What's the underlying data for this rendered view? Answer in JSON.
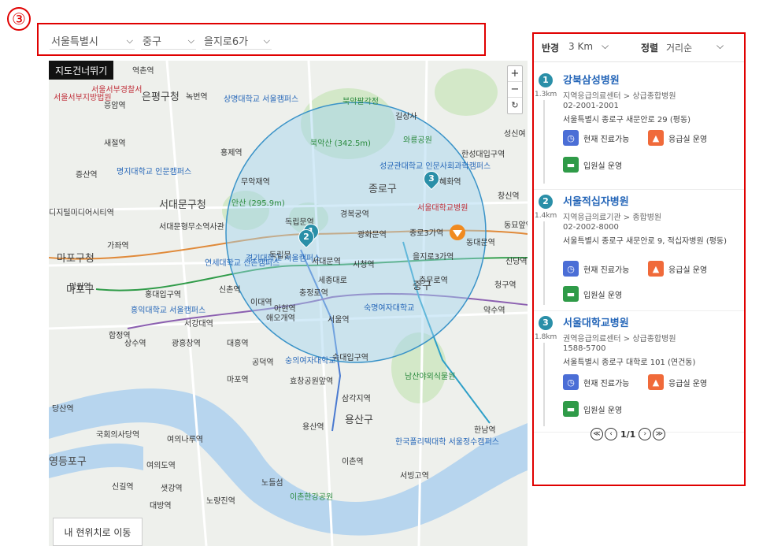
{
  "annotation": {
    "label": "③"
  },
  "filters": {
    "city": "서울특별시",
    "district": "중구",
    "neighborhood": "을지로6가"
  },
  "map": {
    "skip_label": "지도건너뛰기",
    "zoom_in": "+",
    "zoom_out": "−",
    "reset": "↻",
    "locate_label": "내 현위치로 이동",
    "labels": [
      {
        "text": "은평구청",
        "cls": "big"
      },
      {
        "text": "서대문구청",
        "cls": "big"
      },
      {
        "text": "마포구청",
        "cls": "big"
      },
      {
        "text": "마포구",
        "cls": "big"
      },
      {
        "text": "종로구",
        "cls": "big"
      },
      {
        "text": "용산구",
        "cls": "big"
      },
      {
        "text": "영등포구",
        "cls": "big"
      },
      {
        "text": "중구",
        "cls": "big"
      },
      {
        "text": "명지대학교 인문캠퍼스",
        "cls": "blue"
      },
      {
        "text": "연세대학교 신촌캠퍼스",
        "cls": "blue"
      },
      {
        "text": "경기대학교 서울캠퍼스",
        "cls": "blue"
      },
      {
        "text": "성균관대학교 인문사회과학캠퍼스",
        "cls": "blue"
      },
      {
        "text": "상명대학교 서울캠퍼스",
        "cls": "blue"
      },
      {
        "text": "홍익대학교 서울캠퍼스",
        "cls": "blue"
      },
      {
        "text": "숙명여자대학교",
        "cls": "blue"
      },
      {
        "text": "숭의여자대학교",
        "cls": "blue"
      },
      {
        "text": "한국폴리텍대학 서울정수캠퍼스",
        "cls": "blue"
      },
      {
        "text": "서울대학교병원",
        "cls": "red"
      },
      {
        "text": "북악팔각정",
        "cls": "green"
      },
      {
        "text": "북악산 (342.5m)",
        "cls": "green"
      },
      {
        "text": "안산 (295.9m)",
        "cls": "green"
      },
      {
        "text": "와룡공원",
        "cls": "green"
      },
      {
        "text": "남산야외식물원",
        "cls": "green"
      },
      {
        "text": "노들섬",
        "cls": ""
      },
      {
        "text": "이촌한강공원",
        "cls": "green"
      },
      {
        "text": "서울역",
        "cls": ""
      },
      {
        "text": "시청역",
        "cls": ""
      },
      {
        "text": "종로3가역",
        "cls": ""
      },
      {
        "text": "을지로3가역",
        "cls": ""
      },
      {
        "text": "충무로역",
        "cls": ""
      },
      {
        "text": "동대문역",
        "cls": ""
      },
      {
        "text": "신당역",
        "cls": ""
      },
      {
        "text": "청구역",
        "cls": ""
      },
      {
        "text": "약수역",
        "cls": ""
      },
      {
        "text": "공덕역",
        "cls": ""
      },
      {
        "text": "효창공원앞역",
        "cls": ""
      },
      {
        "text": "삼각지역",
        "cls": ""
      },
      {
        "text": "숙대입구역",
        "cls": ""
      },
      {
        "text": "용산역",
        "cls": ""
      },
      {
        "text": "이촌역",
        "cls": ""
      },
      {
        "text": "서빙고역",
        "cls": ""
      },
      {
        "text": "한남역",
        "cls": ""
      },
      {
        "text": "여의도역",
        "cls": ""
      },
      {
        "text": "샛강역",
        "cls": ""
      },
      {
        "text": "신길역",
        "cls": ""
      },
      {
        "text": "대방역",
        "cls": ""
      },
      {
        "text": "노량진역",
        "cls": ""
      },
      {
        "text": "당산역",
        "cls": ""
      },
      {
        "text": "합정역",
        "cls": ""
      },
      {
        "text": "가좌역",
        "cls": ""
      },
      {
        "text": "홍대입구역",
        "cls": ""
      },
      {
        "text": "신촌역",
        "cls": ""
      },
      {
        "text": "이대역",
        "cls": ""
      },
      {
        "text": "아현역",
        "cls": ""
      },
      {
        "text": "애오개역",
        "cls": ""
      },
      {
        "text": "충정로역",
        "cls": ""
      },
      {
        "text": "서대문역",
        "cls": ""
      },
      {
        "text": "독립문역",
        "cls": ""
      },
      {
        "text": "경복궁역",
        "cls": ""
      },
      {
        "text": "광화문역",
        "cls": ""
      },
      {
        "text": "혜화역",
        "cls": ""
      },
      {
        "text": "한성대입구역",
        "cls": ""
      },
      {
        "text": "창신역",
        "cls": ""
      },
      {
        "text": "동묘앞역",
        "cls": ""
      },
      {
        "text": "성신여",
        "cls": ""
      },
      {
        "text": "길상사",
        "cls": ""
      },
      {
        "text": "무악재역",
        "cls": ""
      },
      {
        "text": "홍제역",
        "cls": ""
      },
      {
        "text": "녹번역",
        "cls": ""
      },
      {
        "text": "응암역",
        "cls": ""
      },
      {
        "text": "역촌역",
        "cls": ""
      },
      {
        "text": "새절역",
        "cls": ""
      },
      {
        "text": "증산역",
        "cls": ""
      },
      {
        "text": "디지털미디어시티역",
        "cls": ""
      },
      {
        "text": "망원역",
        "cls": ""
      },
      {
        "text": "마포역",
        "cls": ""
      },
      {
        "text": "상수역",
        "cls": ""
      },
      {
        "text": "광흥창역",
        "cls": ""
      },
      {
        "text": "서강대역",
        "cls": ""
      },
      {
        "text": "대흥역",
        "cls": ""
      },
      {
        "text": "국회의사당역",
        "cls": ""
      },
      {
        "text": "여의나루역",
        "cls": ""
      },
      {
        "text": "서울서부경찰서",
        "cls": ""
      },
      {
        "text": "서울서부지방법원",
        "cls": ""
      },
      {
        "text": "독립문",
        "cls": ""
      },
      {
        "text": "서대문형무소역사관",
        "cls": ""
      },
      {
        "text": "세종대로",
        "cls": ""
      }
    ],
    "markers": [
      {
        "label": "1"
      },
      {
        "label": "2"
      },
      {
        "label": "3"
      }
    ]
  },
  "panel": {
    "radius_label": "반경",
    "radius_value": "3 Km",
    "sort_label": "정렬",
    "sort_value": "거리순",
    "items": [
      {
        "num": "1",
        "dist": "1.3km",
        "name": "강북삼성병원",
        "type": "지역응급의료센터 > 상급종합병원",
        "phone": "02-2001-2001",
        "addr": "서울특별시 종로구 새문안로 29 (평동)",
        "s1": "현재 진료가능",
        "s2": "응급실 운영",
        "s3": "입원실 운영"
      },
      {
        "num": "2",
        "dist": "1.4km",
        "name": "서울적십자병원",
        "type": "지역응급의료기관 > 종합병원",
        "phone": "02-2002-8000",
        "addr": "서울특별시 종로구 새문안로 9, 적십자병원 (평동)",
        "s1": "현재 진료가능",
        "s2": "응급실 운영",
        "s3": "입원실 운영"
      },
      {
        "num": "3",
        "dist": "1.8km",
        "name": "서울대학교병원",
        "type": "권역응급의료센터 > 상급종합병원",
        "phone": "1588-5700",
        "addr": "서울특별시 종로구 대학로 101 (연건동)",
        "s1": "현재 진료가능",
        "s2": "응급실 운영",
        "s3": "입원실 운영"
      }
    ],
    "pager": {
      "first": "≪",
      "prev": "‹",
      "page": "1/1",
      "next": "›",
      "last": "≫"
    }
  },
  "colors": {
    "accent": "#2566b8",
    "marker": "#2a8fa8",
    "highlight": "#e00000",
    "radius_fill": "#9fd3ef"
  }
}
